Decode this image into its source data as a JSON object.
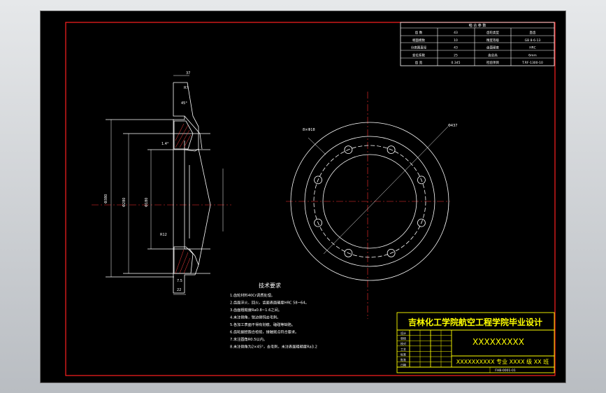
{
  "params_table": {
    "header": "啮 合 参 数",
    "rows": [
      [
        "齿 数",
        "43",
        "齿轮类型",
        "直齿"
      ],
      [
        "端面模数",
        "10",
        "精度等级",
        "GB 8-6-13"
      ],
      [
        "分度圆直径",
        "43",
        "齿面硬度",
        "HRC"
      ],
      [
        "变位系数",
        "25",
        "齿全高",
        "6mm"
      ],
      [
        "齿 宽",
        "0.345",
        "检验项目",
        "T.RF-1300-10"
      ]
    ]
  },
  "tech_requirements": {
    "title": "技术要求",
    "items": [
      "1.齿轮材料40Cr调质处理。",
      "2.齿面淬火、回火，齿面表面硬度HRC 58~64。",
      "3.齿面粗糙度Ra0.8~1.6之间。",
      "4.未注倒角，锐边倒钝去毛刺。",
      "5.各加工表面不得有划痕、磕碰等缺陷。",
      "6.齿轮副经跑合检验，接触斑点符合要求。",
      "7.未注圆角R0.5以内。",
      "8.未注倒角为2×45°，去毛刺，未注表面粗糙度Ra3.2"
    ]
  },
  "title_block": {
    "school": "吉林化工学院航空工程学院毕业设计",
    "drawing_name": "XXXXXXXXX",
    "major_line": "XXXXXXXXXX 专业 XXXX 级 XX 班",
    "code": "FHB-0001-01",
    "left_labels": [
      "设计",
      "审核",
      "校对",
      "工艺",
      "标准",
      "批准",
      "日期"
    ]
  },
  "dimensions": {
    "top_width": "37",
    "small_top": "R7",
    "angle": "45°",
    "chamfer": "1.4°",
    "dia_outer": "Φ380",
    "dia_mid": "Φ280",
    "dia_inner": "Φ180",
    "bottom_a": "R12",
    "bottom_b": "7.5",
    "bottom_c": "22",
    "hole_label": "8×Φ18",
    "circle_label": "Φ437"
  }
}
